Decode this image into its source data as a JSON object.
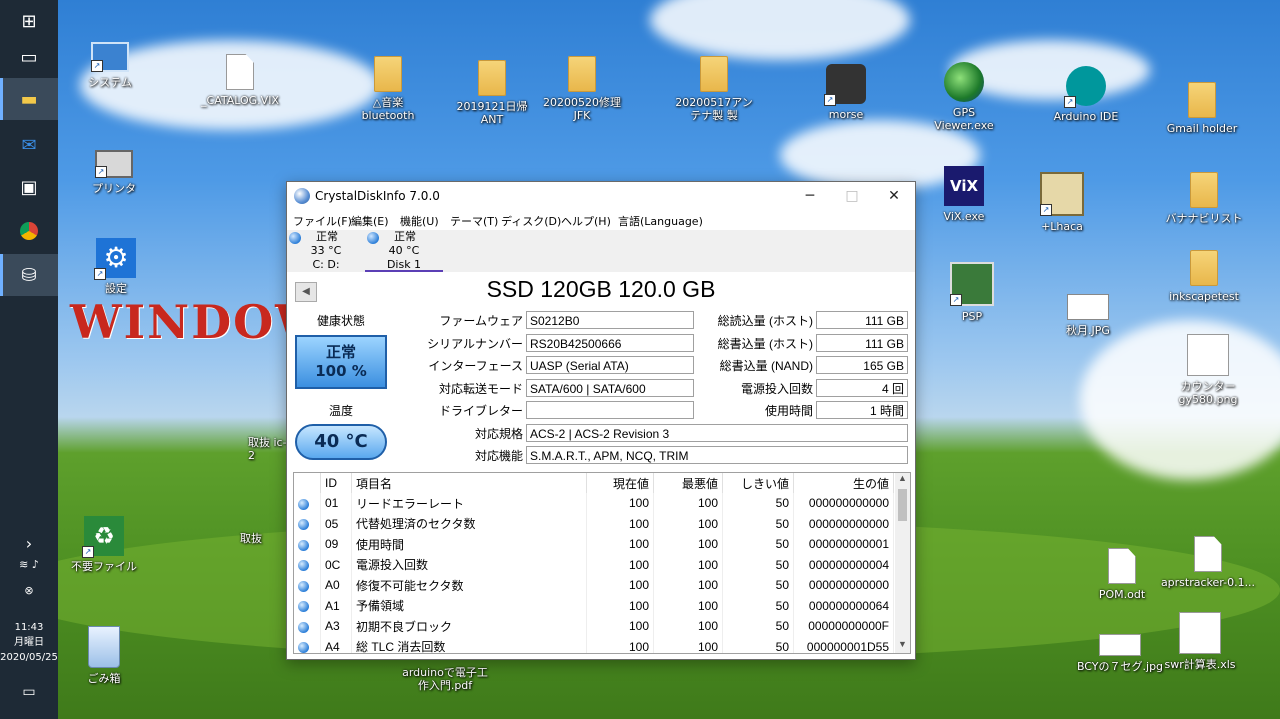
{
  "window": {
    "title": "CrystalDiskInfo 7.0.0",
    "menu": [
      "ファイル(F)",
      "編集(E)",
      "機能(U)",
      "テーマ(T)",
      "ディスク(D)",
      "ヘルプ(H)",
      "言語(Language)"
    ],
    "disks": [
      {
        "status": "正常",
        "temp": "33 °C",
        "name": "C: D:"
      },
      {
        "status": "正常",
        "temp": "40 °C",
        "name": "Disk 1"
      }
    ],
    "model": "SSD 120GB 120.0 GB",
    "health_label": "健康状態",
    "health_status": "正常",
    "health_percent": "100 %",
    "temp_label": "温度",
    "temp_value": "40 °C",
    "fields": {
      "firmware_label": "ファームウェア",
      "firmware": "S0212B0",
      "serial_label": "シリアルナンバー",
      "serial": "RS20B42500666",
      "interface_label": "インターフェース",
      "interface": "UASP (Serial ATA)",
      "transfer_label": "対応転送モード",
      "transfer": "SATA/600 | SATA/600",
      "drive_letter_label": "ドライブレター",
      "drive_letter": "",
      "standard_label": "対応規格",
      "standard": "ACS-2 | ACS-2 Revision 3",
      "features_label": "対応機能",
      "features": "S.M.A.R.T., APM, NCQ, TRIM",
      "host_reads_label": "総読込量 (ホスト)",
      "host_reads": "111 GB",
      "host_writes_label": "総書込量 (ホスト)",
      "host_writes": "111 GB",
      "nand_writes_label": "総書込量 (NAND)",
      "nand_writes": "165 GB",
      "power_count_label": "電源投入回数",
      "power_count": "4 回",
      "power_hours_label": "使用時間",
      "power_hours": "1 時間"
    },
    "smart_headers": [
      "ID",
      "項目名",
      "現在値",
      "最悪値",
      "しきい値",
      "生の値"
    ],
    "smart_rows": [
      {
        "id": "01",
        "name": "リードエラーレート",
        "cur": "100",
        "worst": "100",
        "thr": "50",
        "raw": "000000000000"
      },
      {
        "id": "05",
        "name": "代替処理済のセクタ数",
        "cur": "100",
        "worst": "100",
        "thr": "50",
        "raw": "000000000000"
      },
      {
        "id": "09",
        "name": "使用時間",
        "cur": "100",
        "worst": "100",
        "thr": "50",
        "raw": "000000000001"
      },
      {
        "id": "0C",
        "name": "電源投入回数",
        "cur": "100",
        "worst": "100",
        "thr": "50",
        "raw": "000000000004"
      },
      {
        "id": "A0",
        "name": "修復不可能セクタ数",
        "cur": "100",
        "worst": "100",
        "thr": "50",
        "raw": "000000000000"
      },
      {
        "id": "A1",
        "name": "予備領域",
        "cur": "100",
        "worst": "100",
        "thr": "50",
        "raw": "000000000064"
      },
      {
        "id": "A3",
        "name": "初期不良ブロック",
        "cur": "100",
        "worst": "100",
        "thr": "50",
        "raw": "00000000000F"
      },
      {
        "id": "A4",
        "name": "総 TLC 消去回数",
        "cur": "100",
        "worst": "100",
        "thr": "50",
        "raw": "000000001D55"
      }
    ]
  },
  "desktop_icons": {
    "system": "システム",
    "catalog": "_CATALOG.VIX",
    "bluetooth": "△音楽 bluetooth",
    "f2019": "2019121日帰ANT",
    "f20200520": "20200520修理JFK",
    "f20200517": "20200517アンテナ製 製",
    "morse": "morse",
    "gps": "GPS Viewer.exe",
    "arduino": "Arduino IDE",
    "gmail": "Gmail holder",
    "printer": "プリンタ",
    "vix": "ViX.exe",
    "lhaca": "+Lhaca",
    "banana": "バナナビリスト",
    "settings": "設定",
    "psp": "PSP",
    "akitsuki": "秋月.JPG",
    "inkscape": "inkscapetest",
    "counter": "カウンター gy580.png",
    "recycle_util": "不要ファイル",
    "trash": "ごみ箱",
    "arduino_pdf": "arduinoで電子工作入門.pdf",
    "pom": "POM.odt",
    "aprs": "aprstracker-0.1...",
    "bcy": "BCYの７セグ.jpg",
    "swr": "swr計算表.xls",
    "partial1": "取抜 ic-2",
    "partial2": "取抜"
  },
  "banner": "WINDOWS",
  "taskbar": {
    "time": "11:43",
    "weekday": "月曜日",
    "date": "2020/05/25"
  }
}
